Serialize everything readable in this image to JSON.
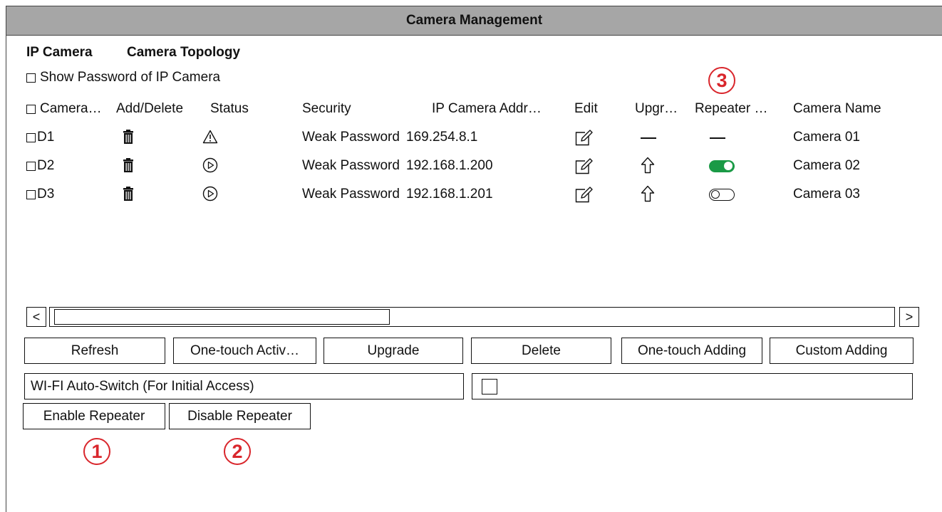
{
  "window": {
    "title": "Camera Management"
  },
  "tabs": [
    {
      "label": "IP Camera"
    },
    {
      "label": "Camera Topology"
    }
  ],
  "show_password": {
    "label": "Show Password of IP Camera",
    "checked": false
  },
  "table": {
    "headers": {
      "camera": "Camera…",
      "add_delete": "Add/Delete",
      "status": "Status",
      "security": "Security",
      "ip_address": "IP Camera Addr…",
      "edit": "Edit",
      "upgrade": "Upgr…",
      "repeater": "Repeater …",
      "camera_name": "Camera Name"
    },
    "rows": [
      {
        "id": "D1",
        "status_icon": "warning-icon",
        "security": "Weak Password",
        "ip": "169.254.8.1",
        "upgrade": "—",
        "repeater": "—",
        "name": "Camera 01"
      },
      {
        "id": "D2",
        "status_icon": "play-icon",
        "security": "Weak Password",
        "ip": "192.168.1.200",
        "upgrade": "up-arrow-icon",
        "repeater": "on",
        "name": "Camera 02"
      },
      {
        "id": "D3",
        "status_icon": "play-icon",
        "security": "Weak Password",
        "ip": "192.168.1.201",
        "upgrade": "up-arrow-icon",
        "repeater": "off",
        "name": "Camera 03"
      }
    ]
  },
  "scrollbar": {
    "left": "<",
    "right": ">"
  },
  "actions": {
    "refresh": "Refresh",
    "activate": "One-touch Activ…",
    "upgrade": "Upgrade",
    "delete": "Delete",
    "one_touch_adding": "One-touch Adding",
    "custom_adding": "Custom Adding"
  },
  "wifi": {
    "label": "WI-FI Auto-Switch (For Initial Access)",
    "checked": false
  },
  "repeater_buttons": {
    "enable": "Enable Repeater",
    "disable": "Disable Repeater"
  },
  "callouts": {
    "one": "1",
    "two": "2",
    "three": "3"
  },
  "colors": {
    "title_bar": "#a6a6a6",
    "toggle_on": "#1a9a46",
    "callout": "#d9262c"
  }
}
